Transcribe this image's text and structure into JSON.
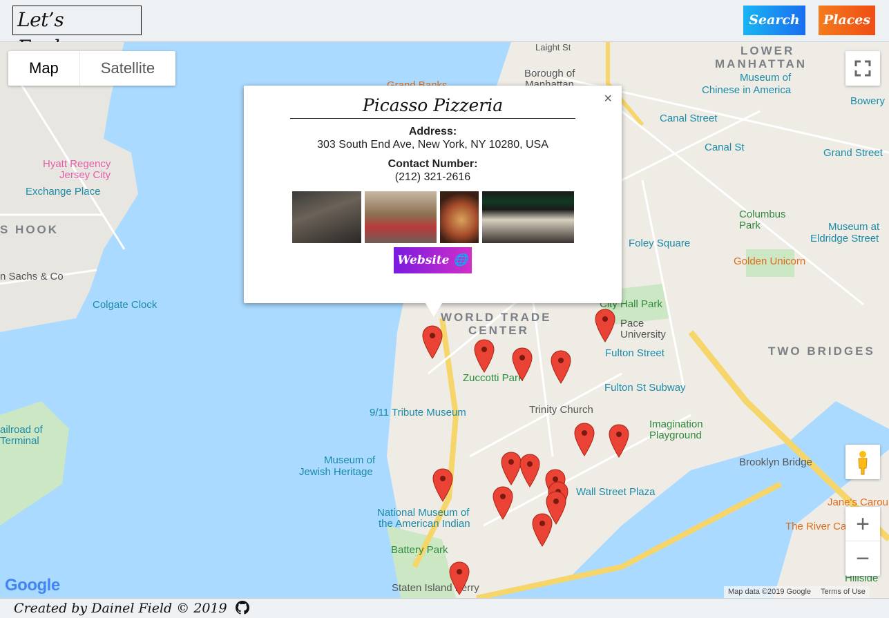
{
  "header": {
    "logo": "Let’s Explore",
    "search_label": "Search",
    "places_label": "Places"
  },
  "map_controls": {
    "map_label": "Map",
    "satellite_label": "Satellite",
    "zoom_in": "+",
    "zoom_out": "−"
  },
  "popup": {
    "title": "Picasso Pizzeria",
    "address_label": "Address:",
    "address": "303 South End Ave, New York, NY 10280, USA",
    "contact_label": "Contact Number:",
    "contact": "(212) 321-2616",
    "website_label": "Website",
    "close": "×"
  },
  "map_labels": [
    "LOWER",
    "MANHATTAN",
    "Museum of",
    "Chinese in America",
    "Bowery",
    "Canal Street",
    "Canal St",
    "Grand Street",
    "Hyatt Regency",
    "Jersey City",
    "Exchange Place",
    "S HOOK",
    "n Sachs & Co",
    "Colgate Clock",
    "WORLD TRADE",
    "CENTER",
    "City Hall Park",
    "Pace University",
    "Fulton Street",
    "Fulton St Subway",
    "Zuccotti Park",
    "9/11 Tribute Museum",
    "Trinity Church",
    "Columbus Park",
    "Foley Square",
    "Museum at",
    "Eldridge Street",
    "Golden Unicorn",
    "TWO BRIDGES",
    "Imagination Playground",
    "Brooklyn Bridge",
    "Museum of",
    "Jewish Heritage",
    "National Museum of",
    "the American Indian",
    "Battery Park",
    "Staten Island Ferry",
    "Wall Street Plaza",
    "Jane's Carou",
    "The River Ca",
    "Borough of",
    "Manhattan",
    "Grand Banks",
    "Laight St",
    "Hillside",
    "ailroad of",
    "Terminal"
  ],
  "attribution": {
    "logo": "Google",
    "data": "Map data ©2019 Google",
    "terms": "Terms of Use"
  },
  "footer": {
    "credit": "Created by Dainel Field © 2019"
  }
}
